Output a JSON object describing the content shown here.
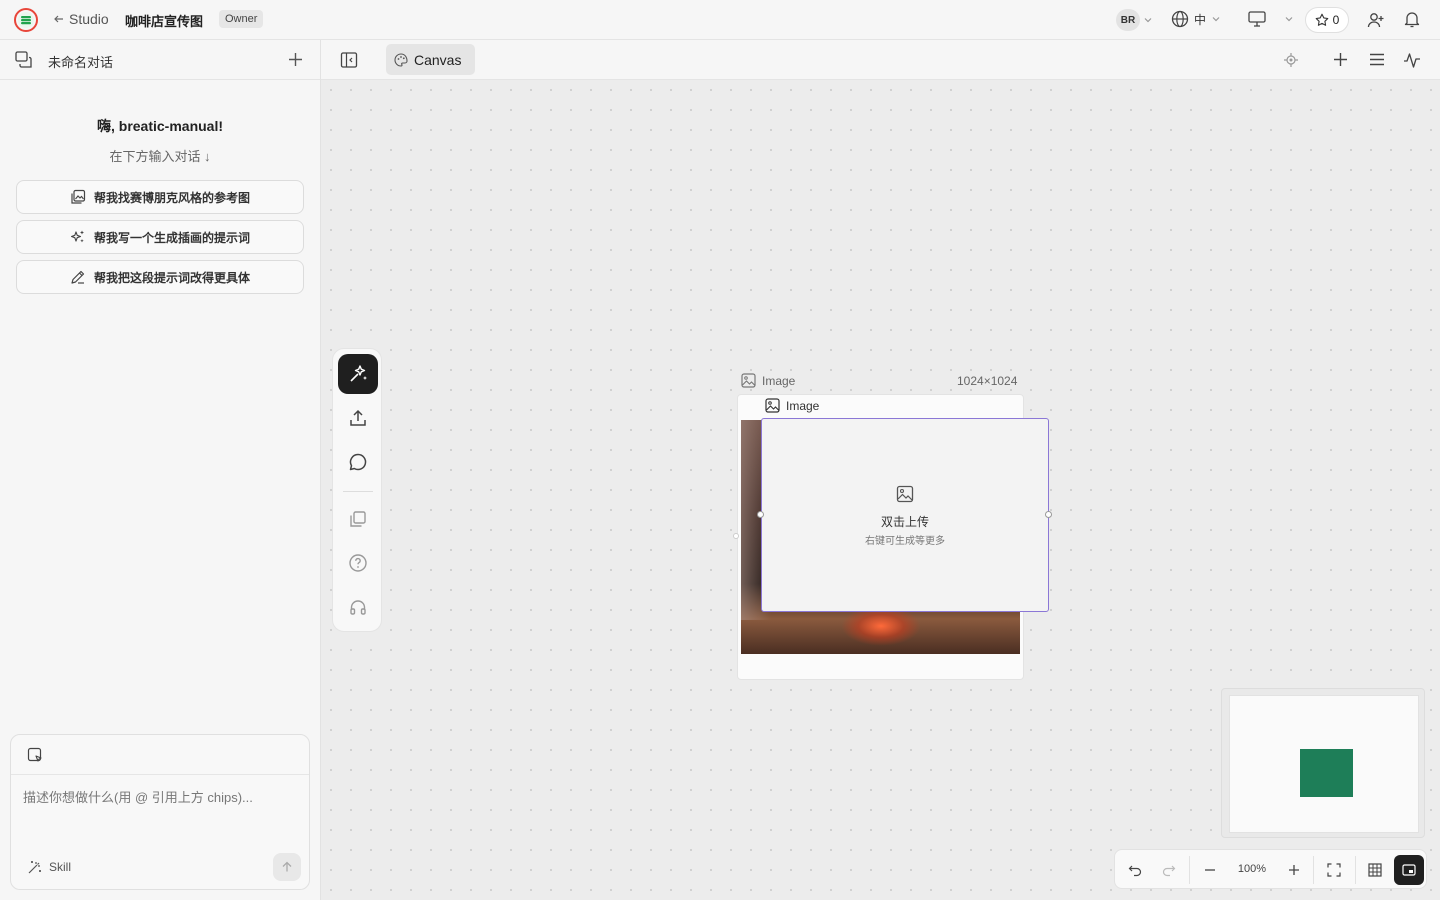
{
  "app": {
    "back_label": "Studio",
    "project_title": "咖啡店宣传图",
    "role_badge": "Owner",
    "user_initials": "BR",
    "language": "中",
    "star_count": "0"
  },
  "sidebar": {
    "conversation_title": "未命名对话",
    "greeting": "嗨, breatic-manual!",
    "greeting_sub": "在下方输入对话 ↓",
    "suggestions": [
      {
        "label": "帮我找赛博朋克风格的参考图",
        "icon": "image-search-icon"
      },
      {
        "label": "帮我写一个生成插画的提示词",
        "icon": "sparkles-icon"
      },
      {
        "label": "帮我把这段提示词改得更具体",
        "icon": "pencil-icon"
      }
    ],
    "composer": {
      "placeholder": "描述你想做什么(用 @ 引用上方 chips)...",
      "skill_label": "Skill"
    }
  },
  "canvas": {
    "tab_label": "Canvas",
    "node": {
      "label": "Image",
      "size": "1024×1024",
      "inner_label": "Image",
      "upload_title": "双击上传",
      "upload_sub": "右键可生成等更多"
    },
    "zoom": "100%"
  },
  "colors": {
    "accent_purple": "#8b77d6",
    "minimap_node": "#1e7e58",
    "active_tool": "#1f1f1f"
  }
}
